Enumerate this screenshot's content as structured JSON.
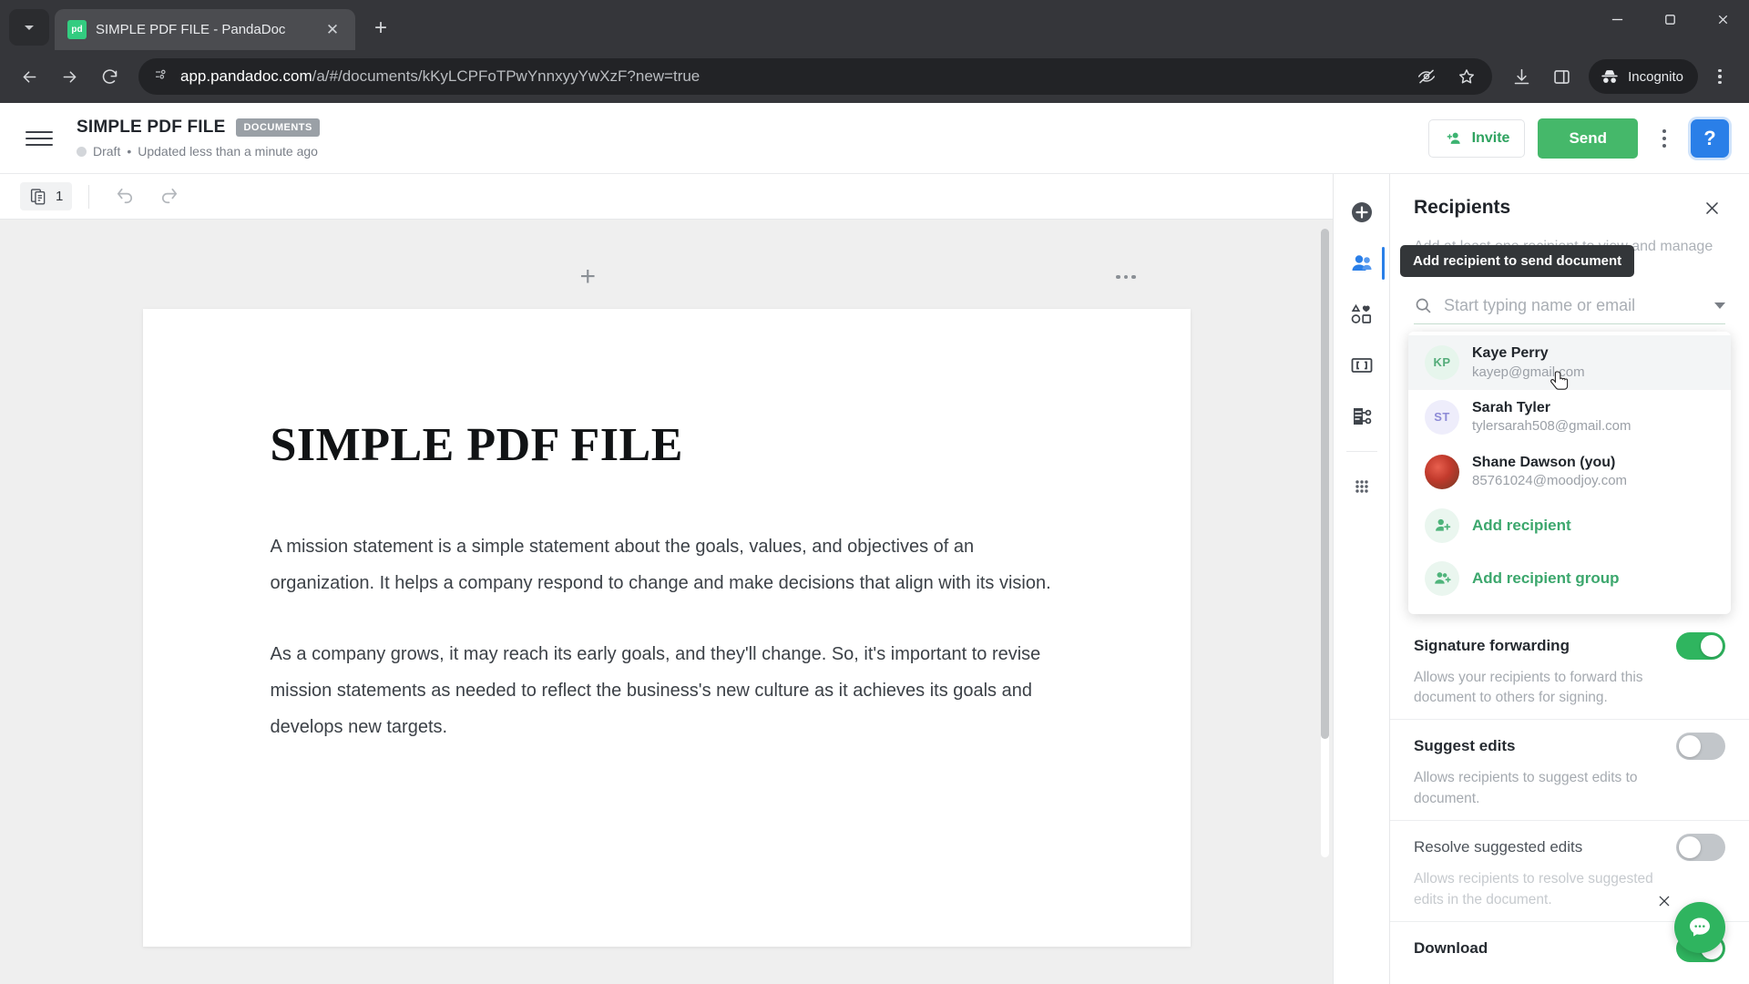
{
  "browser": {
    "tab": {
      "title": "SIMPLE PDF FILE - PandaDoc",
      "favicon_text": "pd",
      "close_label": "✕"
    },
    "newtab_label": "+",
    "window": {
      "minimize": "minimize-icon",
      "maximize": "maximize-icon",
      "close": "close-icon"
    },
    "nav": {
      "back": "back-icon",
      "forward": "forward-icon",
      "reload": "reload-icon"
    },
    "omnibox": {
      "url_host": "app.pandadoc.com",
      "url_path": "/a/#/documents/kKyLCPFoTPwYnnxyyYwXzF?new=true",
      "full_url": "app.pandadoc.com/a/#/documents/kKyLCPFoTPwYnnxyyYwXzF?new=true",
      "site_info_icon": "page-info-icon"
    },
    "toolbar_icons": [
      "eye-off-icon",
      "bookmark-star-icon",
      "download-icon",
      "side-panel-icon"
    ],
    "incognito_label": "Incognito",
    "menu_icon": "chrome-menu-icon"
  },
  "app_header": {
    "menu_icon": "hamburger-icon",
    "title": "SIMPLE PDF FILE",
    "badge": "DOCUMENTS",
    "status": "Draft",
    "separator": "•",
    "updated": "Updated less than a minute ago",
    "invite_label": "Invite",
    "send_label": "Send",
    "more_icon": "kebab-menu-icon",
    "help_label": "?",
    "accent_green": "#45b86a",
    "accent_blue": "#2a7fe8"
  },
  "editor": {
    "toolbar": {
      "pages_count": "1",
      "pages_icon": "pages-icon",
      "undo_icon": "undo-icon",
      "redo_icon": "redo-icon"
    },
    "page_controls": {
      "add_block": "+",
      "more": "page-more-icon"
    },
    "document": {
      "heading": "SIMPLE PDF FILE",
      "paragraphs": [
        "A mission statement is a simple statement about the goals, values, and objectives of an organization. It helps a company respond to change and make decisions that align with its vision.",
        "As a company grows, it may reach its early goals, and they'll change. So, it's important to revise mission statements as needed to reflect the business's new culture as it achieves its goals and develops new targets."
      ]
    }
  },
  "rail": {
    "items": [
      {
        "name": "add-content-icon",
        "active": false
      },
      {
        "name": "recipients-icon",
        "active": true
      },
      {
        "name": "content-library-icon",
        "active": false
      },
      {
        "name": "variables-icon",
        "active": false
      },
      {
        "name": "workflow-icon",
        "active": false
      },
      {
        "name": "apps-grid-icon",
        "active": false
      }
    ]
  },
  "panel": {
    "title": "Recipients",
    "close_icon": "close-icon",
    "hint": "Add at least one recipient to view and manage roles in the document.",
    "tooltip": "Add recipient to send document",
    "search": {
      "placeholder": "Start typing name or email",
      "value": "",
      "icon": "search-icon",
      "caret": "chevron-down-icon"
    },
    "recipients": [
      {
        "initials": "KP",
        "name": "Kaye Perry",
        "email": "kayep@gmail.com",
        "avatar_style": "av-kp",
        "hovered": true
      },
      {
        "initials": "ST",
        "name": "Sarah Tyler",
        "email": "tylersarah508@gmail.com",
        "avatar_style": "av-st",
        "hovered": false
      },
      {
        "initials": "",
        "name": "Shane Dawson (you)",
        "email": "85761024@moodjoy.com",
        "avatar_style": "av-photo",
        "hovered": false
      }
    ],
    "actions": [
      {
        "label": "Add recipient",
        "icon": "add-person-icon"
      },
      {
        "label": "Add recipient group",
        "icon": "add-group-icon"
      }
    ],
    "settings": [
      {
        "label": "Signature forwarding",
        "description": "Allows your recipients to forward this document to others for signing.",
        "enabled": true,
        "muted": false
      },
      {
        "label": "Suggest edits",
        "description": "Allows recipients to suggest edits to document.",
        "enabled": false,
        "muted": false
      },
      {
        "label": "Resolve suggested edits",
        "description": "Allows recipients to resolve suggested edits in the document.",
        "enabled": false,
        "muted": true
      },
      {
        "label": "Download",
        "description": "",
        "enabled": true,
        "muted": false
      }
    ]
  },
  "chat": {
    "icon": "chat-bubble-icon",
    "close_icon": "close-icon"
  }
}
